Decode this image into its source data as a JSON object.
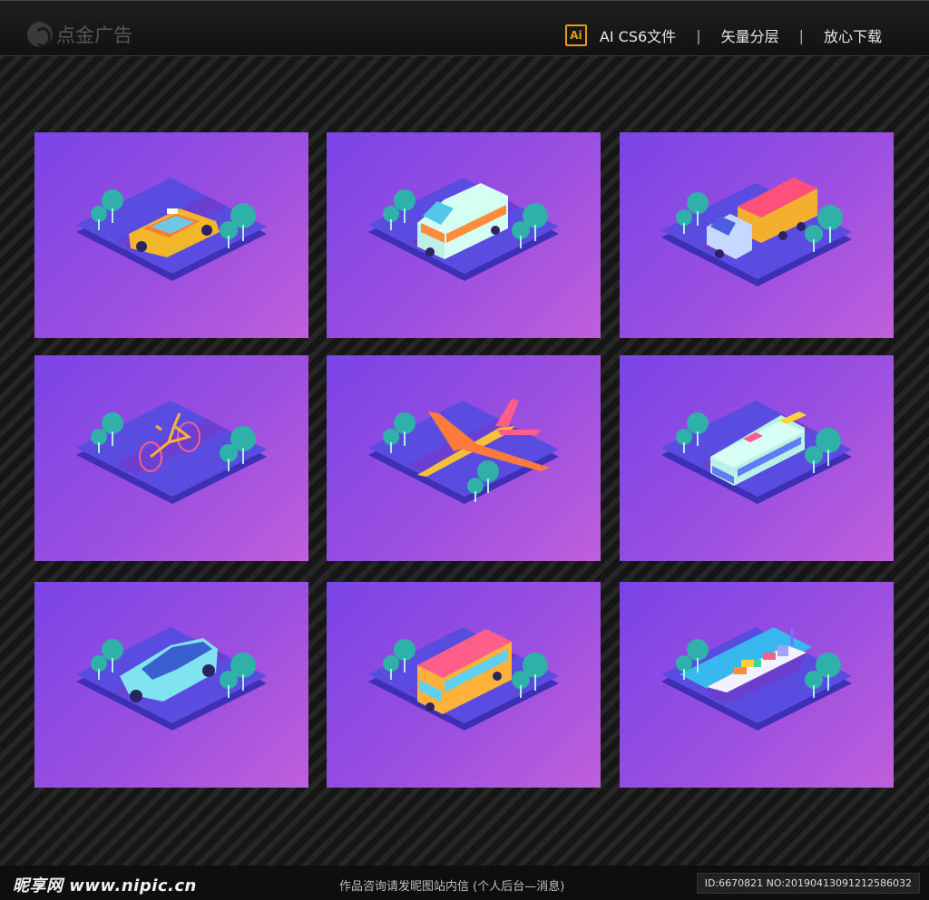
{
  "header": {
    "logo_text": "点金广告",
    "ai_badge": "Ai",
    "format": "AI CS6文件",
    "separator": "|",
    "vector": "矢量分层",
    "download": "放心下载"
  },
  "tiles": [
    {
      "name": "taxi",
      "icon": "taxi-icon"
    },
    {
      "name": "ambulance",
      "icon": "ambulance-icon"
    },
    {
      "name": "dump-truck",
      "icon": "dump-truck-icon"
    },
    {
      "name": "bicycle",
      "icon": "bicycle-icon"
    },
    {
      "name": "airplane",
      "icon": "airplane-icon"
    },
    {
      "name": "tram",
      "icon": "tram-icon"
    },
    {
      "name": "car",
      "icon": "car-icon"
    },
    {
      "name": "bus",
      "icon": "bus-icon"
    },
    {
      "name": "cargo-ship",
      "icon": "cargo-ship-icon"
    }
  ],
  "colors": {
    "tile_start": "#7a44e6",
    "tile_end": "#bf5fdb",
    "platform": "#5a4ce0",
    "tree": "#2fb0a8"
  },
  "footer": {
    "site": "昵享网 www.nipic.cn",
    "notice": "作品咨询请发昵图站内信 (个人后台—消息)",
    "id_text": "ID:6670821 NO:20190413091212586032"
  }
}
